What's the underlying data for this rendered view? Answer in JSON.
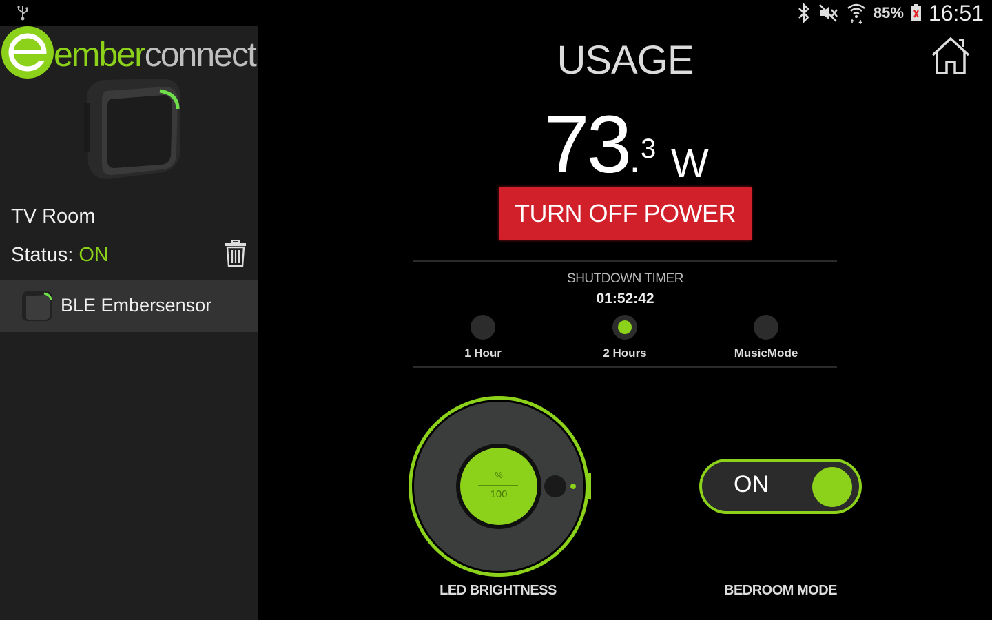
{
  "status_bar": {
    "battery": "85%",
    "time": "16:51"
  },
  "sidebar": {
    "logo_ember": "ember",
    "logo_connect": "connect",
    "room_name": "TV Room",
    "status_label": "Status: ",
    "status_value": "ON",
    "device": "BLE Embersensor"
  },
  "main": {
    "title": "USAGE",
    "usage_integer": "73",
    "usage_dot": ".",
    "usage_decimal": "3",
    "usage_unit": "W",
    "turn_off_label": "TURN OFF POWER",
    "timer_title": "SHUTDOWN TIMER",
    "timer_value": "01:52:42",
    "timer_options": [
      {
        "label": "1 Hour",
        "selected": false
      },
      {
        "label": "2 Hours",
        "selected": true
      },
      {
        "label": "MusicMode",
        "selected": false
      }
    ],
    "knob": {
      "unit": "%",
      "max": "100",
      "label": "LED BRIGHTNESS"
    },
    "toggle": {
      "state": "ON",
      "label": "BEDROOM MODE"
    }
  },
  "colors": {
    "accent": "#8cd11a",
    "danger": "#d2202a",
    "sidebar_bg": "#1f1f1f"
  }
}
